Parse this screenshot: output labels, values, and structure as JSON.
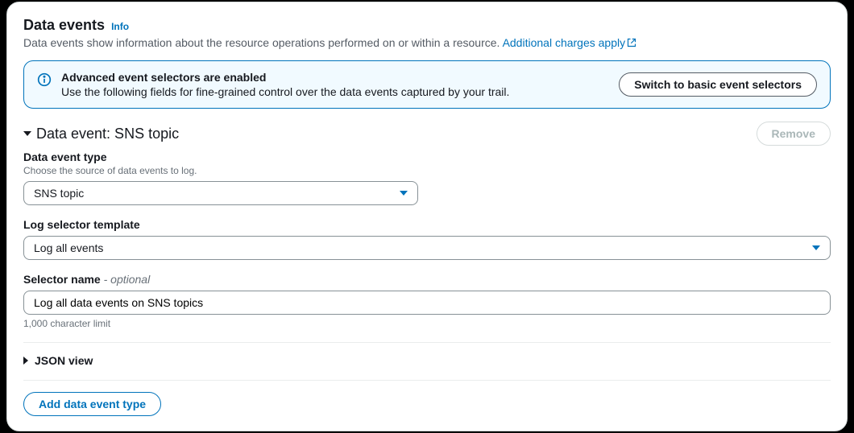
{
  "header": {
    "title": "Data events",
    "info": "Info",
    "description": "Data events show information about the resource operations performed on or within a resource. ",
    "charges_link": "Additional charges apply"
  },
  "alert": {
    "title": "Advanced event selectors are enabled",
    "text": "Use the following fields for fine-grained control over the data events captured by your trail.",
    "button": "Switch to basic event selectors"
  },
  "section": {
    "title": "Data event: SNS topic",
    "remove": "Remove"
  },
  "form": {
    "type_label": "Data event type",
    "type_hint": "Choose the source of data events to log.",
    "type_value": "SNS topic",
    "template_label": "Log selector template",
    "template_value": "Log all events",
    "selector_label": "Selector name",
    "selector_optional": " - optional",
    "selector_value": "Log all data events on SNS topics",
    "selector_hint": "1,000 character limit"
  },
  "json_view": "JSON view",
  "add_button": "Add data event type"
}
